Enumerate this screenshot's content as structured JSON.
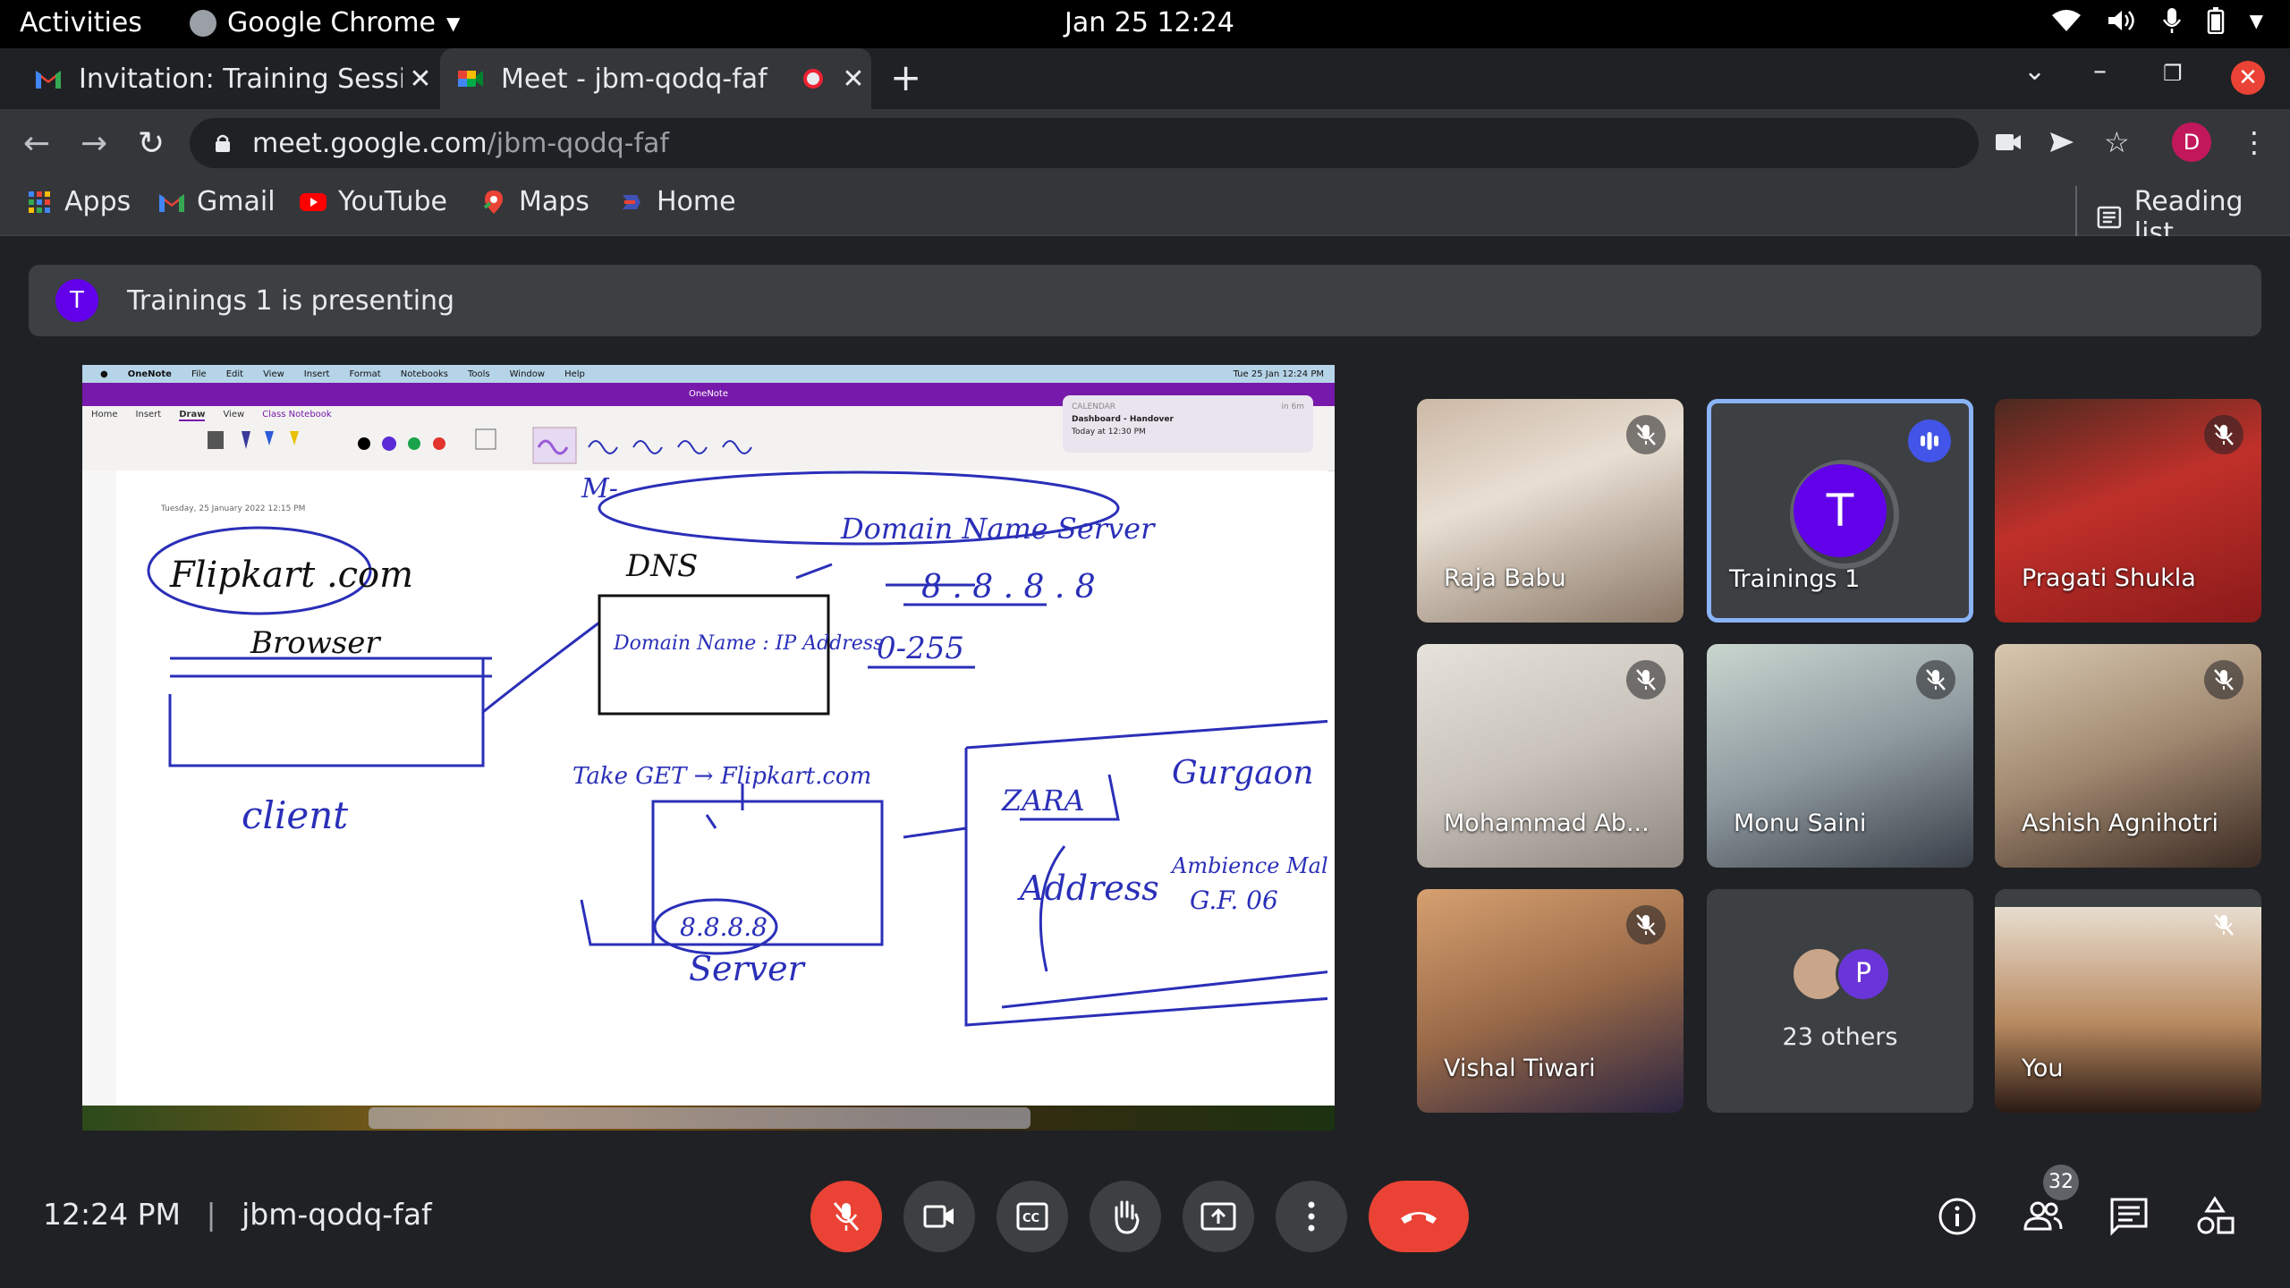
{
  "os_topbar": {
    "activities": "Activities",
    "app_name": "Google Chrome",
    "clock": "Jan 25  12:24"
  },
  "tabs": [
    {
      "title": "Invitation: Training Session",
      "close": "✕"
    },
    {
      "title": "Meet - jbm-qodq-faf",
      "close": "✕"
    }
  ],
  "toolbar": {
    "url_host": "meet.google.com",
    "url_path": "/jbm-qodq-faf",
    "profile_initial": "D"
  },
  "bookmarks": [
    {
      "label": "Apps"
    },
    {
      "label": "Gmail"
    },
    {
      "label": "YouTube"
    },
    {
      "label": "Maps"
    },
    {
      "label": "Home"
    }
  ],
  "reading_list": "Reading list",
  "presenting_bar": {
    "avatar_initial": "T",
    "text": "Trainings 1 is presenting"
  },
  "shared_screen": {
    "menu_items": [
      "OneNote",
      "File",
      "Edit",
      "View",
      "Insert",
      "Format",
      "Notebooks",
      "Tools",
      "Window",
      "Help"
    ],
    "mac_clock": "Tue 25 Jan  12:24 PM",
    "window_title": "OneNote",
    "ribbon_tabs": [
      "Home",
      "Insert",
      "Draw",
      "View",
      "Class Notebook"
    ],
    "selected_ribbon_tab": "Draw",
    "notification": {
      "app": "CALENDAR",
      "time_ago": "in 6m",
      "title": "Dashboard - Handover",
      "subtitle": "Today at 12:30 PM"
    },
    "page_date": "Tuesday, 25 January 2022      12:15 PM",
    "handwriting": {
      "flipkart": "Flipkart .com",
      "dns": "DNS",
      "domain_name_server": "Domain Name Server",
      "domain_ip": "Domain Name : IP Address",
      "ip_example": "8 . 8 . 8 . 8",
      "range": "0-255",
      "browser": "Browser",
      "client": "client",
      "get": "Take GET → Flipkart.com",
      "server_ip": "8.8.8.8",
      "server": "Server",
      "zara": "ZARA",
      "gurgaon": "Gurgaon",
      "address": "Address",
      "mall": "Ambience Mall",
      "floor": "G.F. 06",
      "top_scribble": "M-"
    }
  },
  "participants": [
    {
      "name": "Raja Babu",
      "muted": true
    },
    {
      "name": "Trainings 1",
      "initial": "T",
      "speaking": true
    },
    {
      "name": "Pragati Shukla",
      "muted": true
    },
    {
      "name": "Mohammad Ab...",
      "muted": true
    },
    {
      "name": "Monu Saini",
      "muted": true
    },
    {
      "name": "Ashish Agnihotri",
      "muted": true
    },
    {
      "name": "Vishal Tiwari",
      "muted": true
    },
    {
      "name": "23 others",
      "initial": "P"
    },
    {
      "name": "You",
      "muted": true
    }
  ],
  "bottom_bar": {
    "time": "12:24 PM",
    "separator": "|",
    "meeting_code": "jbm-qodq-faf",
    "people_count": "32"
  },
  "colors": {
    "end_call": "#ea4335",
    "presenter_avatar": "#6200ea",
    "speaking_border": "#8ab4f8",
    "meet_bg": "#202124",
    "onenote_purple": "#7719aa",
    "ink_blue": "#2a2fb8"
  }
}
